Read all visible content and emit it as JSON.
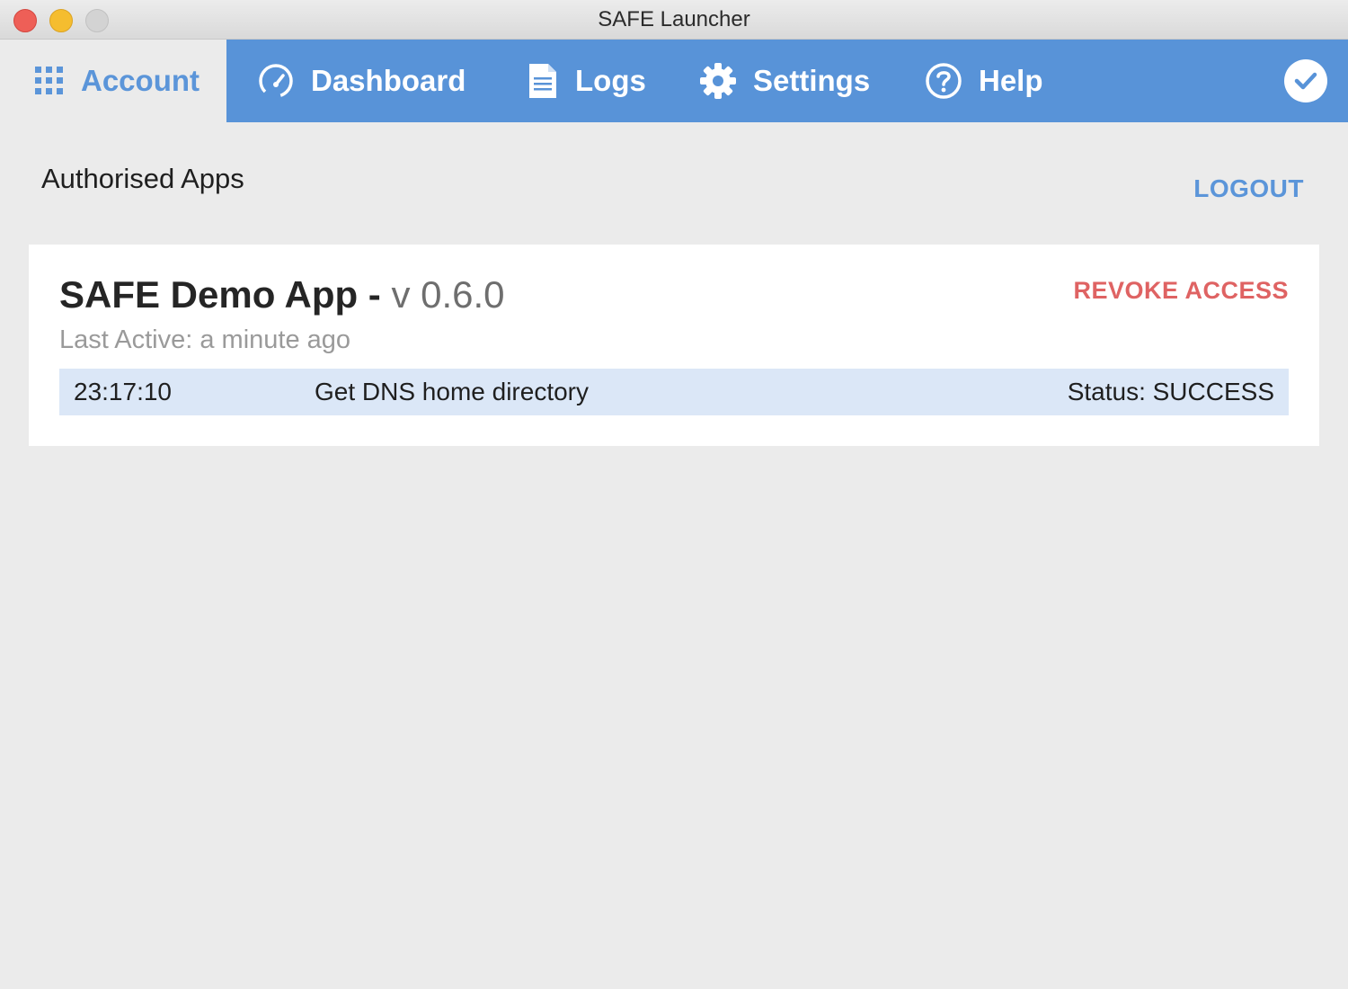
{
  "window": {
    "title": "SAFE Launcher"
  },
  "nav": {
    "items": [
      {
        "label": "Account",
        "icon": "grid-icon",
        "active": true
      },
      {
        "label": "Dashboard",
        "icon": "speedometer-icon",
        "active": false
      },
      {
        "label": "Logs",
        "icon": "document-icon",
        "active": false
      },
      {
        "label": "Settings",
        "icon": "gear-icon",
        "active": false
      },
      {
        "label": "Help",
        "icon": "question-circle-icon",
        "active": false
      }
    ],
    "status_icon": "check-circle-icon"
  },
  "page": {
    "heading": "Authorised Apps",
    "logout_label": "LOGOUT"
  },
  "apps": [
    {
      "name": "SAFE Demo App",
      "separator": " - ",
      "version": "v 0.6.0",
      "last_active": "Last Active: a minute ago",
      "revoke_label": "REVOKE ACCESS",
      "logs": [
        {
          "time": "23:17:10",
          "action": "Get DNS home directory",
          "status": "Status: SUCCESS"
        }
      ]
    }
  ],
  "colors": {
    "nav_background": "#5893d8",
    "accent_blue": "#5b95d9",
    "revoke_red": "#df6363",
    "log_row_highlight": "#dbe7f7",
    "content_background": "#ebebeb"
  }
}
